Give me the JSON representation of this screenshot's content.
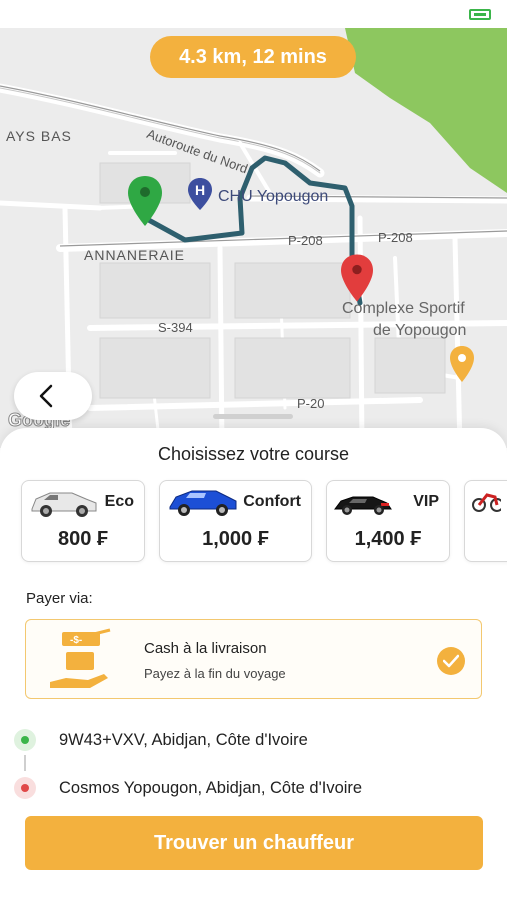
{
  "map": {
    "route_summary": "4.3 km, 12 mins",
    "labels": {
      "ays_bas": "AYS BAS",
      "autoroute": "Autoroute du Nord",
      "chu": "CHU Yopougon",
      "annaneraie": "ANNANERAIE",
      "p208_a": "P-208",
      "p208_b": "P-208",
      "s394": "S-394",
      "p20": "P-20",
      "complexe_1": "Complexe Sportif",
      "complexe_2": "de Yopougon"
    },
    "brand_mark": "Google",
    "colors": {
      "route": "#2e5f6e",
      "park": "#8dc75f",
      "origin_pin": "#2fa844",
      "dest_pin": "#e23d3d",
      "poi_pin": "#f3b13e"
    }
  },
  "sheet": {
    "title": "Choisissez votre course",
    "vehicles": [
      {
        "name": "Eco",
        "price": "800 ₣",
        "icon": "white-car-icon"
      },
      {
        "name": "Confort",
        "price": "1,000 ₣",
        "icon": "blue-car-icon"
      },
      {
        "name": "VIP",
        "price": "1,400 ₣",
        "icon": "black-sports-car-icon"
      }
    ],
    "payment_label": "Payer via:",
    "payment_option": {
      "title": "Cash à la livraison",
      "subtitle": "Payez à la fin du voyage",
      "selected": true
    },
    "pickup": "9W43+VXV, Abidjan, Côte d'Ivoire",
    "dropoff": "Cosmos Yopougon, Abidjan, Côte d'Ivoire",
    "cta": "Trouver un chauffeur"
  },
  "colors": {
    "accent": "#f3b13e",
    "pickup_dot": "#3bb54a",
    "dropoff_dot": "#e04848"
  }
}
